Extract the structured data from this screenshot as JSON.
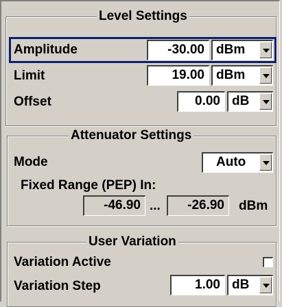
{
  "level": {
    "title": "Level Settings",
    "amplitude": {
      "label": "Amplitude",
      "value": "-30.00",
      "unit": "dBm"
    },
    "limit": {
      "label": "Limit",
      "value": "19.00",
      "unit": "dBm"
    },
    "offset": {
      "label": "Offset",
      "value": "0.00",
      "unit": "dB"
    }
  },
  "attenuator": {
    "title": "Attenuator Settings",
    "mode": {
      "label": "Mode",
      "value": "Auto"
    },
    "fixed_range": {
      "label": "Fixed Range (PEP) In:",
      "min": "-46.90",
      "separator": "...",
      "max": "-26.90",
      "unit": "dBm"
    }
  },
  "user_variation": {
    "title": "User Variation",
    "active": {
      "label": "Variation Active",
      "checked": false
    },
    "step": {
      "label": "Variation Step",
      "value": "1.00",
      "unit": "dB"
    }
  },
  "colors": {
    "background": "#d4d0c8",
    "focus_border": "#0a1f6e"
  },
  "icons": [
    "dropdown-arrow-icon"
  ]
}
